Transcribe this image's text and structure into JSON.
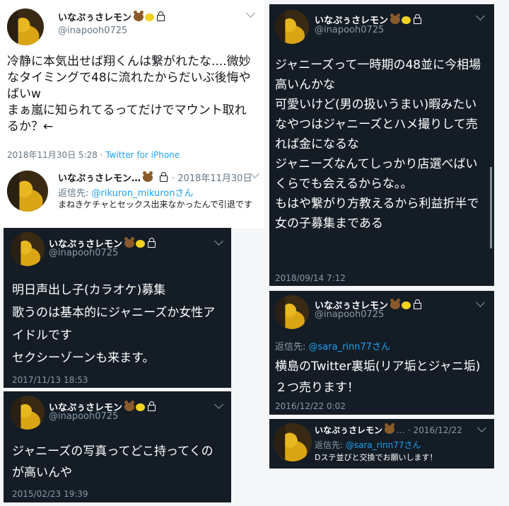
{
  "user": {
    "name": "いなぷぅさレモン",
    "name_short": "いなぷぅさレモン…",
    "handle": "@inapooh0725"
  },
  "tweets": [
    {
      "body": "冷静に本気出せば翔くんは繋がれたな....微妙なタイミングで48に流れたからだいぶ後悔やばいw\nまぁ嵐に知られてるってだけでマウント取れるか？←",
      "time": "2018年11月30日 5:28 ·",
      "source": "Twitter for iPhone"
    },
    {
      "header_time": "· 2018年11月30日",
      "reply_label": "返信先:",
      "reply_to": "@rikuron_mikuronさん",
      "body": "まねきケチャとセックス出来なかったんで引退です"
    },
    {
      "body": "ジャニーズって一時期の48並に今相場高いんかな\n可愛いけど(男の扱いうまい)暇みたいなやつはジャニーズとハメ撮りして売れば金になるな\nジャニーズなんてしっかり店選べばいくらでも会えるからな。。\nもはや繋がり方教えるから利益折半で女の子募集まである",
      "time": "2018/09/14 7:12"
    },
    {
      "body": "明日声出し子(カラオケ)募集\n歌うのは基本的にジャニーズか女性アイドルです\nセクシーゾーンも来ます。",
      "time": "2017/11/13 18:53"
    },
    {
      "reply_label": "返信先:",
      "reply_to": "@sara_rinn77さん",
      "body": "横島のTwitter裏垢(リア垢とジャニ垢)２つ売ります！",
      "time": "2016/12/22 0:02"
    },
    {
      "body": "ジャニーズの写真ってどこ持ってくのが高いんや",
      "time": "2015/02/23 19:39"
    },
    {
      "header_time": "· 2016/12/22",
      "reply_label": "返信先:",
      "reply_to": "@sara_rinn77さん",
      "body": "Dステ並びと交換でお願いします！"
    }
  ],
  "colors": {
    "dark_bg": "#141d26",
    "light_bg": "#ffffff",
    "link": "#1da1f2"
  },
  "icons": [
    "bear-emoji",
    "lemon-emoji",
    "lock-icon",
    "chevron-down-icon"
  ]
}
